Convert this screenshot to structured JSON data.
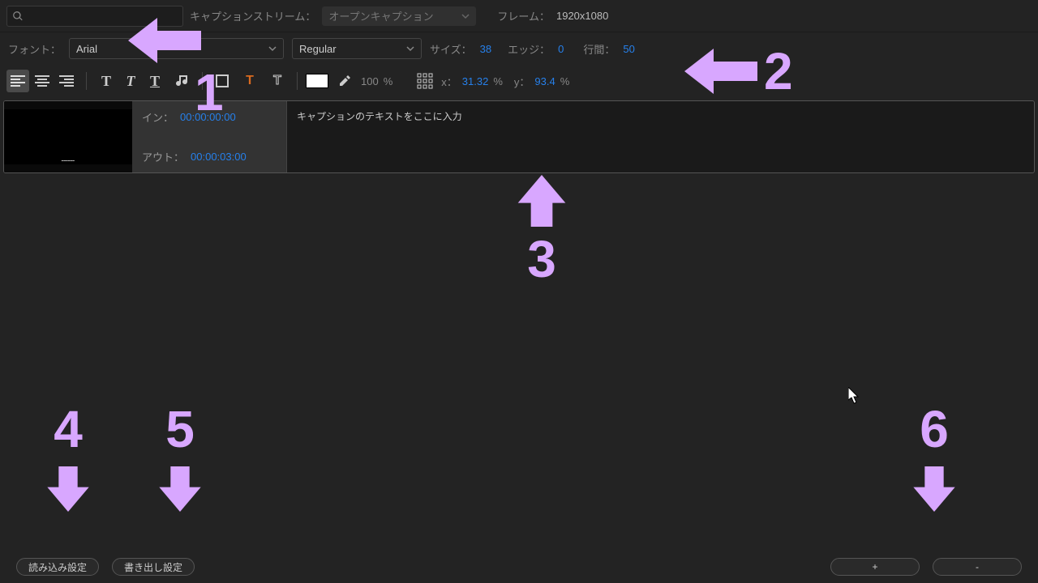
{
  "top": {
    "stream_label": "キャプションストリーム：",
    "stream_value": "オープンキャプション",
    "frame_label": "フレーム：",
    "frame_value": "1920x1080"
  },
  "font": {
    "label": "フォント：",
    "family": "Arial",
    "style": "Regular",
    "size_label": "サイズ：",
    "size": "38",
    "edge_label": "エッジ：",
    "edge": "0",
    "leading_label": "行間：",
    "leading": "50"
  },
  "toolbar": {
    "opacity": "100",
    "pct": "%",
    "x_label": "x：",
    "x": "31.32",
    "y_label": "y：",
    "y": "93.4"
  },
  "caption": {
    "in_label": "イン：",
    "in": "00:00:00:00",
    "out_label": "アウト：",
    "out": "00:00:03:00",
    "text": "キャプションのテキストをここに入力"
  },
  "bottom": {
    "import": "読み込み設定",
    "export": "書き出し設定",
    "plus": "+",
    "minus": "-"
  },
  "annot": {
    "n1": "1",
    "n2": "2",
    "n3": "3",
    "n4": "4",
    "n5": "5",
    "n6": "6"
  }
}
